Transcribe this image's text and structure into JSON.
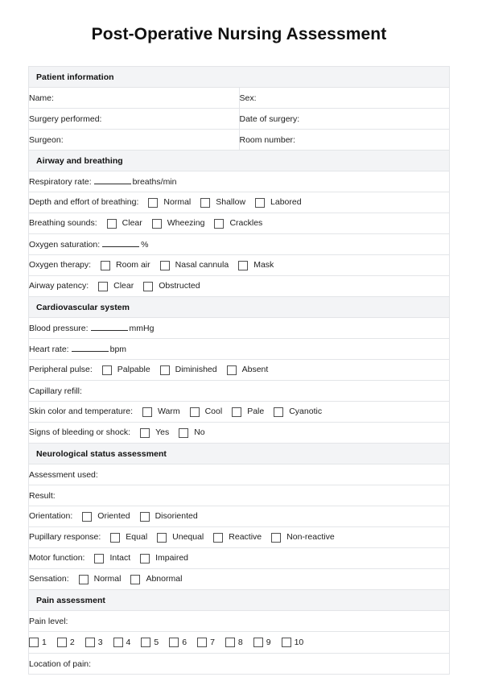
{
  "document": {
    "title": "Post-Operative Nursing Assessment"
  },
  "sections": [
    {
      "heading": "Patient information",
      "pairs": [
        {
          "left": "Name:",
          "right": "Sex:"
        },
        {
          "left": "Surgery performed:",
          "right": "Date of surgery:"
        },
        {
          "left": "Surgeon:",
          "right": "Room number:"
        }
      ]
    },
    {
      "heading": "Airway and breathing",
      "rows": [
        {
          "label": "Respiratory rate:",
          "blank": true,
          "suffix": "breaths/min"
        },
        {
          "label": "Depth and effort of breathing:",
          "options": [
            "Normal",
            "Shallow",
            "Labored"
          ]
        },
        {
          "label": "Breathing sounds:",
          "options": [
            "Clear",
            "Wheezing",
            "Crackles"
          ]
        },
        {
          "label": "Oxygen saturation:",
          "blank": true,
          "suffix": "%"
        },
        {
          "label": "Oxygen therapy:",
          "options": [
            "Room air",
            "Nasal cannula",
            "Mask"
          ]
        },
        {
          "label": "Airway patency:",
          "options": [
            "Clear",
            "Obstructed"
          ]
        }
      ]
    },
    {
      "heading": "Cardiovascular system",
      "rows": [
        {
          "label": "Blood pressure:",
          "blank": true,
          "suffix": "mmHg"
        },
        {
          "label": "Heart rate:",
          "blank": true,
          "suffix": "bpm"
        },
        {
          "label": "Peripheral pulse:",
          "options": [
            "Palpable",
            "Diminished",
            "Absent"
          ]
        },
        {
          "label": "Capillary refill:"
        },
        {
          "label": "Skin color and temperature:",
          "options": [
            "Warm",
            "Cool",
            "Pale",
            "Cyanotic"
          ]
        },
        {
          "label": "Signs of bleeding or shock:",
          "options": [
            "Yes",
            "No"
          ]
        }
      ]
    },
    {
      "heading": "Neurological status assessment",
      "rows": [
        {
          "label": "Assessment used:"
        },
        {
          "label": "Result:"
        },
        {
          "label": "Orientation:",
          "options": [
            "Oriented",
            "Disoriented"
          ]
        },
        {
          "label": "Pupillary response:",
          "options": [
            "Equal",
            "Unequal",
            "Reactive",
            "Non-reactive"
          ]
        },
        {
          "label": "Motor function:",
          "options": [
            "Intact",
            "Impaired"
          ]
        },
        {
          "label": "Sensation:",
          "options": [
            "Normal",
            "Abnormal"
          ]
        }
      ]
    },
    {
      "heading": "Pain assessment",
      "rows": [
        {
          "label": "Pain level:"
        },
        {
          "scale": [
            "1",
            "2",
            "3",
            "4",
            "5",
            "6",
            "7",
            "8",
            "9",
            "10"
          ]
        },
        {
          "label": "Location of pain:"
        }
      ]
    }
  ],
  "colors": {
    "section_header_bg": "#f3f4f6",
    "border": "#e3e5e8",
    "checkbox_border": "#4f4f4f",
    "text": "#1d1d1d"
  }
}
